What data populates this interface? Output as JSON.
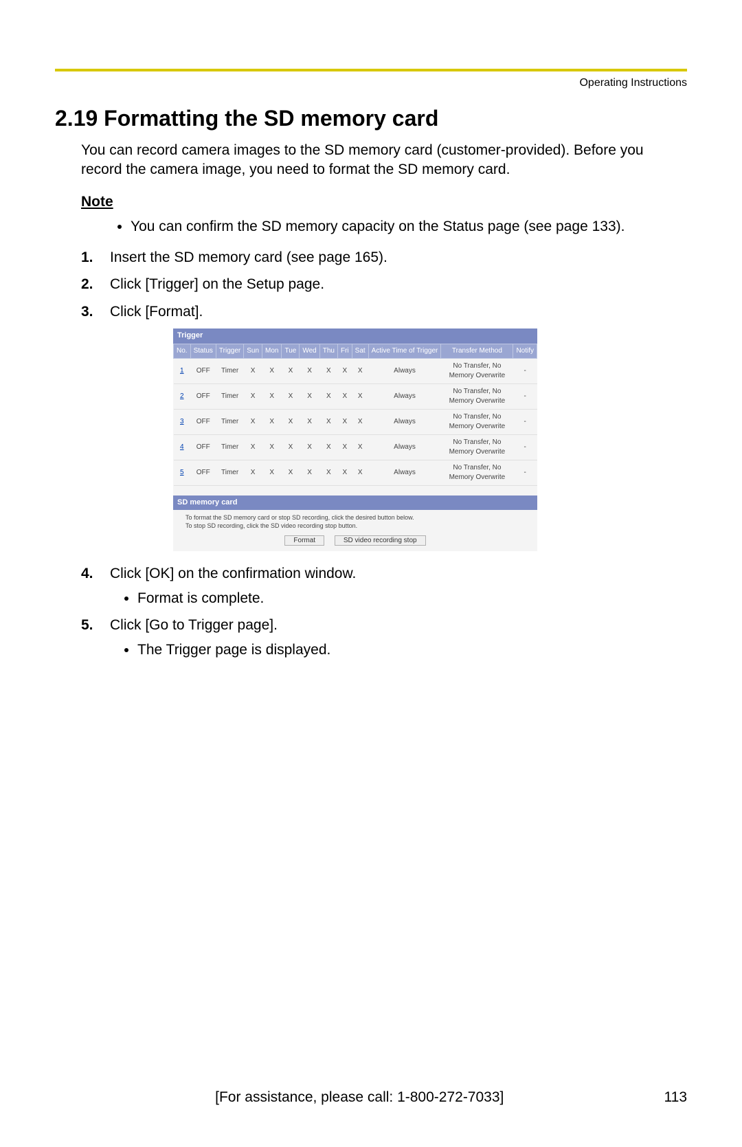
{
  "header": {
    "label": "Operating Instructions"
  },
  "title": "2.19  Formatting the SD memory card",
  "intro": "You can record camera images to the SD memory card (customer-provided). Before you record the camera image, you need to format the SD memory card.",
  "note": {
    "heading": "Note",
    "items": [
      "You can confirm the SD memory capacity on the Status page (see page 133)."
    ]
  },
  "steps": [
    {
      "num": "1.",
      "text": "Insert the SD memory card (see page 165)."
    },
    {
      "num": "2.",
      "text": "Click [Trigger] on the Setup page."
    },
    {
      "num": "3.",
      "text": "Click [Format]."
    },
    {
      "num": "4.",
      "text": "Click [OK] on the confirmation window.",
      "sub": [
        "Format is complete."
      ]
    },
    {
      "num": "5.",
      "text": "Click [Go to Trigger page].",
      "sub": [
        "The Trigger page is displayed."
      ]
    }
  ],
  "screenshot": {
    "trigger_title": "Trigger",
    "columns": [
      "No.",
      "Status",
      "Trigger",
      "Sun",
      "Mon",
      "Tue",
      "Wed",
      "Thu",
      "Fri",
      "Sat",
      "Active Time of Trigger",
      "Transfer Method",
      "Notify"
    ],
    "rows": [
      {
        "no": "1",
        "status": "OFF",
        "trigger": "Timer",
        "days": [
          "X",
          "X",
          "X",
          "X",
          "X",
          "X",
          "X"
        ],
        "active": "Always",
        "transfer": "No Transfer, No Memory Overwrite",
        "notify": "-"
      },
      {
        "no": "2",
        "status": "OFF",
        "trigger": "Timer",
        "days": [
          "X",
          "X",
          "X",
          "X",
          "X",
          "X",
          "X"
        ],
        "active": "Always",
        "transfer": "No Transfer, No Memory Overwrite",
        "notify": "-"
      },
      {
        "no": "3",
        "status": "OFF",
        "trigger": "Timer",
        "days": [
          "X",
          "X",
          "X",
          "X",
          "X",
          "X",
          "X"
        ],
        "active": "Always",
        "transfer": "No Transfer, No Memory Overwrite",
        "notify": "-"
      },
      {
        "no": "4",
        "status": "OFF",
        "trigger": "Timer",
        "days": [
          "X",
          "X",
          "X",
          "X",
          "X",
          "X",
          "X"
        ],
        "active": "Always",
        "transfer": "No Transfer, No Memory Overwrite",
        "notify": "-"
      },
      {
        "no": "5",
        "status": "OFF",
        "trigger": "Timer",
        "days": [
          "X",
          "X",
          "X",
          "X",
          "X",
          "X",
          "X"
        ],
        "active": "Always",
        "transfer": "No Transfer, No Memory Overwrite",
        "notify": "-"
      }
    ],
    "sd_title": "SD memory card",
    "sd_desc1": "To format the SD memory card or stop SD recording, click the desired button below.",
    "sd_desc2": "To stop SD recording, click the SD video recording stop button.",
    "btn_format": "Format",
    "btn_stop": "SD video recording stop"
  },
  "footer": {
    "assist": "[For assistance, please call: 1-800-272-7033]",
    "page": "113"
  }
}
